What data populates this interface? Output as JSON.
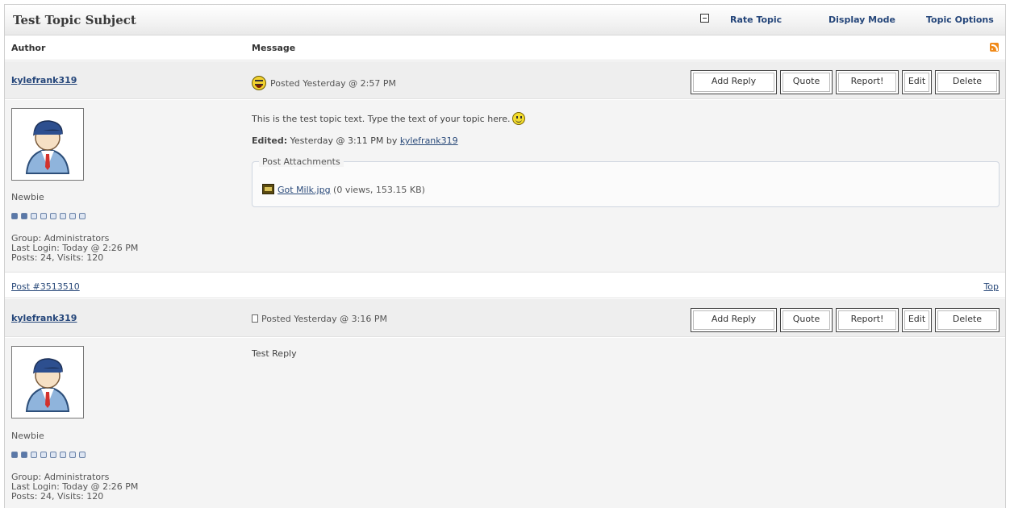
{
  "topic": {
    "title": "Test Topic Subject",
    "links": [
      "Rate Topic",
      "Display Mode",
      "Topic Options"
    ]
  },
  "columns": {
    "author": "Author",
    "message": "Message"
  },
  "buttons": [
    "Add Reply",
    "Quote",
    "Report!",
    "Edit",
    "Delete"
  ],
  "posts": [
    {
      "author": "kylefrank319",
      "posted": "Posted Yesterday @ 2:57 PM",
      "icon": "emoticon-icon",
      "text": "This is the test topic text.  Type the text of your topic here.",
      "edited_label": "Edited:",
      "edited_text": " Yesterday @ 3:11 PM by ",
      "edited_by": "kylefrank319",
      "attachments_label": "Post Attachments",
      "attachment": {
        "name": "Got Milk.jpg",
        "meta": " (0 views, 153.15 KB)"
      },
      "rank": "Newbie",
      "rank_level": 2,
      "rank_max": 8,
      "group": "Group: Administrators",
      "last_login": "Last Login: Today @ 2:26 PM",
      "stats": "Posts: 24, Visits: 120",
      "post_id": "Post #3513510",
      "top_label": "Top"
    },
    {
      "author": "kylefrank319",
      "posted": "Posted Yesterday @ 3:16 PM",
      "icon": "document-icon",
      "text": "Test Reply",
      "rank": "Newbie",
      "rank_level": 2,
      "rank_max": 8,
      "group": "Group: Administrators",
      "last_login": "Last Login: Today @ 2:26 PM",
      "stats": "Posts: 24, Visits: 120"
    }
  ]
}
